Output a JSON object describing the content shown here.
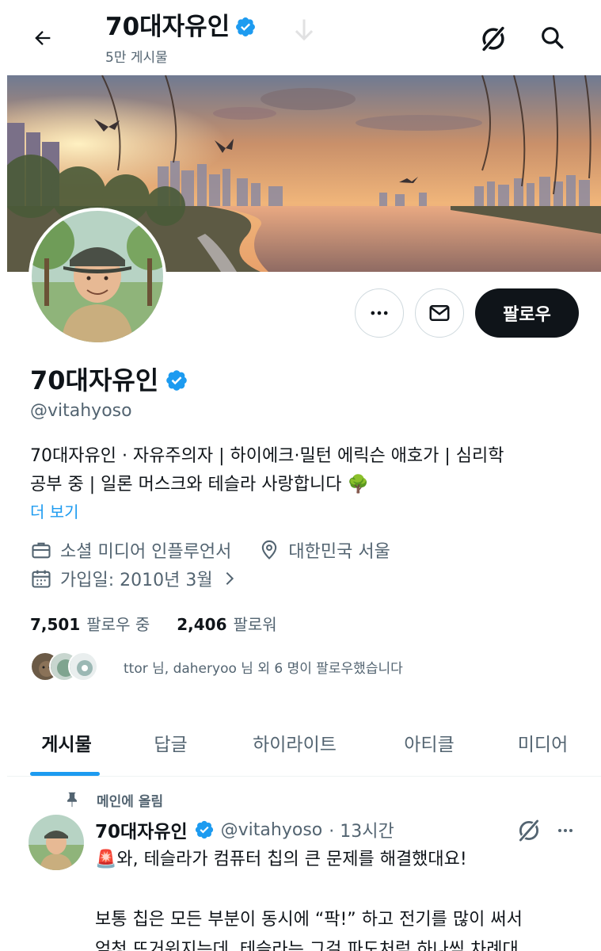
{
  "topbar": {
    "title": "70대자유인",
    "post_count": "5만 게시물"
  },
  "profile": {
    "name": "70대자유인",
    "handle": "@vitahyoso",
    "bio_line1": "70대자유인 · 자유주의자 | 하이에크·밀턴 에릭슨 애호가 | 심리학",
    "bio_line2": "공부 중 | 일론 머스크와 테슬라 사랑합니다 🌳",
    "more_link": "더 보기",
    "category": "소셜 미디어 인플루언서",
    "location": "대한민국 서울",
    "joined": "가입일: 2010년 3월",
    "following_count": "7,501",
    "following_label": "팔로우 중",
    "followers_count": "2,406",
    "followers_label": "팔로워",
    "followed_by": "ttor 님, daheryoo 님 외 6 명이 팔로우했습니다"
  },
  "actions": {
    "follow_label": "팔로우"
  },
  "tabs": [
    {
      "label": "게시물",
      "active": true
    },
    {
      "label": "답글",
      "active": false
    },
    {
      "label": "하이라이트",
      "active": false
    },
    {
      "label": "아티클",
      "active": false
    },
    {
      "label": "미디어",
      "active": false
    }
  ],
  "post": {
    "pinned_label": "메인에 올림",
    "author": "70대자유인",
    "handle": "@vitahyoso",
    "time": "· 13시간",
    "line1": "🚨와, 테슬라가 컴퓨터 칩의 큰 문제를 해결했대요!",
    "line2": "보통 칩은 모든 부분이 동시에 “팍!” 하고 전기를 많이 써서",
    "line3": "엄청 뜨거워지는데, 테슬라는 그걸 파도처럼 하나씩 차례대"
  },
  "colors": {
    "accent": "#1d9bf0",
    "text": "#0f1419",
    "muted": "#536471",
    "button_dark": "#0f1419"
  },
  "icons": [
    "back-arrow-icon",
    "verified-badge-icon",
    "grok-icon",
    "search-icon",
    "more-icon",
    "mail-icon",
    "briefcase-icon",
    "location-icon",
    "calendar-icon",
    "chevron-right-icon",
    "pin-icon"
  ]
}
